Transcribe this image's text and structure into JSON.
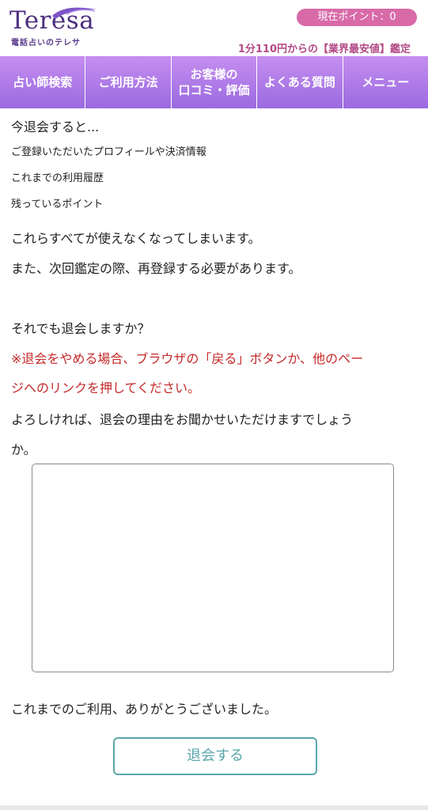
{
  "header": {
    "logo_text": "Teresa",
    "logo_sub": "電話占いのテレサ",
    "points_label": "現在ポイント：0",
    "tagline": "1分110円からの【業界最安値】鑑定"
  },
  "nav": {
    "items": [
      {
        "label": "占い師検索"
      },
      {
        "label": "ご利用方法"
      },
      {
        "label": "お客様の\n口コミ・評価"
      },
      {
        "label": "よくある質問"
      },
      {
        "label": "メニュー"
      }
    ]
  },
  "content": {
    "intro": "今退会すると...",
    "items": [
      "ご登録いただいたプロフィールや決済情報",
      "これまでの利用履歴",
      "残っているポイント"
    ],
    "warning1": "これらすべてが使えなくなってしまいます。",
    "warning2": "また、次回鑑定の際、再登録する必要があります。",
    "confirm_question": "それでも退会しますか？",
    "note_line1": "※退会をやめる場合、ブラウザの「戻る」ボタンか、他のペー",
    "note_line2": "ジへのリンクを押してください。",
    "reason_line1": "よろしければ、退会の理由をお聞かせいただけますでしょう",
    "reason_line2": "か。",
    "reason_value": "",
    "thanks": "これまでのご利用、ありがとうございました。",
    "submit_label": "退会する"
  },
  "colors": {
    "brand_purple": "#9b6ae0",
    "badge_pink": "#d86aa8",
    "warning_red": "#c42a2a",
    "button_teal": "#5aa6aa"
  }
}
